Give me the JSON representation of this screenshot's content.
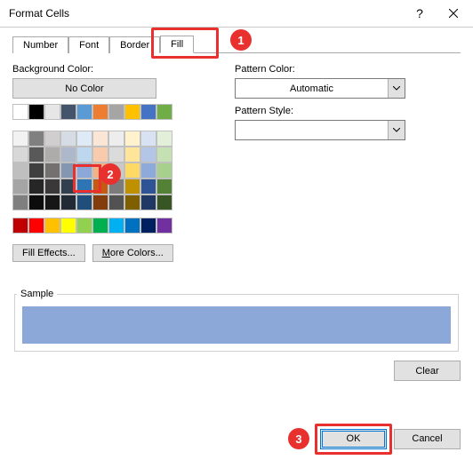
{
  "window": {
    "title": "Format Cells"
  },
  "tabs": [
    "Number",
    "Font",
    "Border",
    "Fill"
  ],
  "left": {
    "bg_label": "Background Color:",
    "no_color": "No Color",
    "fill_effects": "Fill Effects...",
    "more_colors": "More Colors...",
    "auto_row": [
      "#ffffff",
      "#000000",
      "#e7e6e6",
      "#44546a",
      "#5b9bd5",
      "#ed7d31",
      "#a5a5a5",
      "#ffc000",
      "#4472c4",
      "#70ad47"
    ],
    "theme_rows": [
      [
        "#f2f2f2",
        "#808080",
        "#d0cece",
        "#d6dce4",
        "#deebf6",
        "#fbe5d5",
        "#ededed",
        "#fff2cc",
        "#d9e2f3",
        "#e2efd9"
      ],
      [
        "#d8d8d8",
        "#595959",
        "#aeabab",
        "#adb9ca",
        "#bdd7ee",
        "#f7cbac",
        "#dbdbdb",
        "#fee599",
        "#b4c6e7",
        "#c5e0b3"
      ],
      [
        "#bfbfbf",
        "#3f3f3f",
        "#757070",
        "#8496b0",
        "#8ba8d9",
        "#f4b183",
        "#c9c9c9",
        "#ffd965",
        "#8eaadb",
        "#a8d08d"
      ],
      [
        "#a5a5a5",
        "#262626",
        "#3a3838",
        "#323f4f",
        "#2e75b5",
        "#c55a11",
        "#7b7b7b",
        "#bf9000",
        "#2f5496",
        "#538135"
      ],
      [
        "#7f7f7f",
        "#0c0c0c",
        "#171616",
        "#222a35",
        "#1e4e79",
        "#833c0b",
        "#525252",
        "#7f6000",
        "#1f3864",
        "#375623"
      ]
    ],
    "standard_row": [
      "#c00000",
      "#ff0000",
      "#ffc000",
      "#ffff00",
      "#92d050",
      "#00b050",
      "#00b0f0",
      "#0070c0",
      "#002060",
      "#7030a0"
    ],
    "selected_color": "#8ba8d9"
  },
  "right": {
    "pattern_color_label": "Pattern Color:",
    "pattern_color_value": "Automatic",
    "pattern_style_label": "Pattern Style:",
    "pattern_style_value": ""
  },
  "sample": {
    "label": "Sample"
  },
  "buttons": {
    "clear": "Clear",
    "ok": "OK",
    "cancel": "Cancel"
  },
  "annotations": [
    "1",
    "2",
    "3"
  ]
}
